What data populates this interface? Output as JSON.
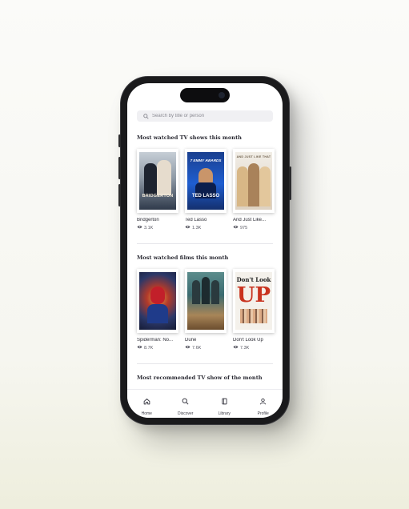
{
  "search": {
    "placeholder": "Search by title or person"
  },
  "sections": [
    {
      "title": "Most watched TV shows this month",
      "items": [
        {
          "title": "Bridgerton",
          "views": "3.1K",
          "poster_text": "BRIDGERTON",
          "poster_colors": [
            "#3d4a5c",
            "#b9c2cc"
          ]
        },
        {
          "title": "Ted Lasso",
          "views": "1.3K",
          "poster_text": "TED LASSO",
          "poster_banner": "7 EMMY AWARDS",
          "poster_colors": [
            "#0d2a6b",
            "#1e57c9"
          ]
        },
        {
          "title": "And Just Like...",
          "views": "975",
          "poster_text": "AND JUST LIKE THAT",
          "poster_colors": [
            "#e8e2d8",
            "#c7b39a"
          ]
        }
      ]
    },
    {
      "title": "Most watched films this month",
      "items": [
        {
          "title": "Spiderman: No...",
          "views": "8.7K",
          "poster_colors": [
            "#2b3760",
            "#c7452c"
          ]
        },
        {
          "title": "Dune",
          "views": "7.6K",
          "poster_colors": [
            "#2f5e63",
            "#b98c58"
          ]
        },
        {
          "title": "Don't Look Up",
          "views": "7.3K",
          "poster_text": "Don't Look UP",
          "poster_colors": [
            "#f3f0ea",
            "#c9331f"
          ]
        }
      ]
    },
    {
      "title": "Most recommended TV show of the month"
    }
  ],
  "tabs": [
    {
      "label": "Home",
      "icon": "home-icon"
    },
    {
      "label": "Discover",
      "icon": "search-icon"
    },
    {
      "label": "Library",
      "icon": "book-icon"
    },
    {
      "label": "Profile",
      "icon": "user-icon"
    }
  ]
}
